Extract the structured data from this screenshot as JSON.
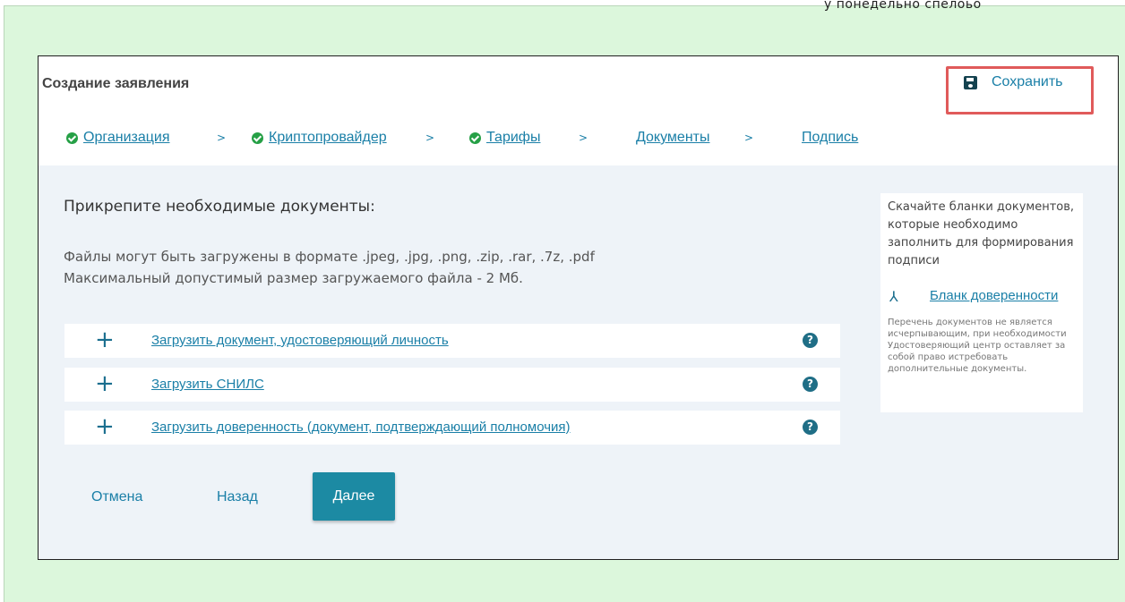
{
  "page": {
    "top_cut_text": "у понедельно спелоьо"
  },
  "header": {
    "title": "Создание заявления",
    "save_label": "Сохранить"
  },
  "steps": [
    {
      "label": "Организация",
      "done": true
    },
    {
      "label": "Криптопровайдер",
      "done": true
    },
    {
      "label": "Тарифы",
      "done": true
    },
    {
      "label": "Документы",
      "done": false
    },
    {
      "label": "Подпись",
      "done": false
    }
  ],
  "step_separator": ">",
  "main": {
    "heading": "Прикрепите необходимые документы:",
    "formats_text": "Файлы могут быть загружены в формате .jpeg, .jpg, .png, .zip, .rar, .7z, .pdf",
    "size_text": "Максимальный допустимый размер загружаемого файла - 2 Мб.",
    "uploads": [
      {
        "label": "Загрузить документ, удостоверяющий личность"
      },
      {
        "label": "Загрузить СНИЛС"
      },
      {
        "label": "Загрузить доверенность (документ, подтверждающий полномочия)"
      }
    ]
  },
  "sidebar": {
    "download_text": "Скачайте бланки документов, которые необходимо заполнить для формирования подписи",
    "blank_link": "Бланк доверенности",
    "note": "Перечень документов не является исчерпывающим, при необходимости Удостоверяющий центр оставляет за собой право истребовать дополнительные документы."
  },
  "footer": {
    "cancel": "Отмена",
    "back": "Назад",
    "next": "Далее"
  },
  "colors": {
    "accent": "#1a7fa7",
    "primary_button": "#1c8aa3",
    "check": "#26a046",
    "highlight_border": "#e05a5a",
    "page_background": "#dcf7dc"
  },
  "icons": {
    "save": "floppy-disk-icon",
    "step_done": "check-circle-icon",
    "add": "plus-icon",
    "help": "question-circle-icon",
    "pdf": "pdf-icon"
  }
}
